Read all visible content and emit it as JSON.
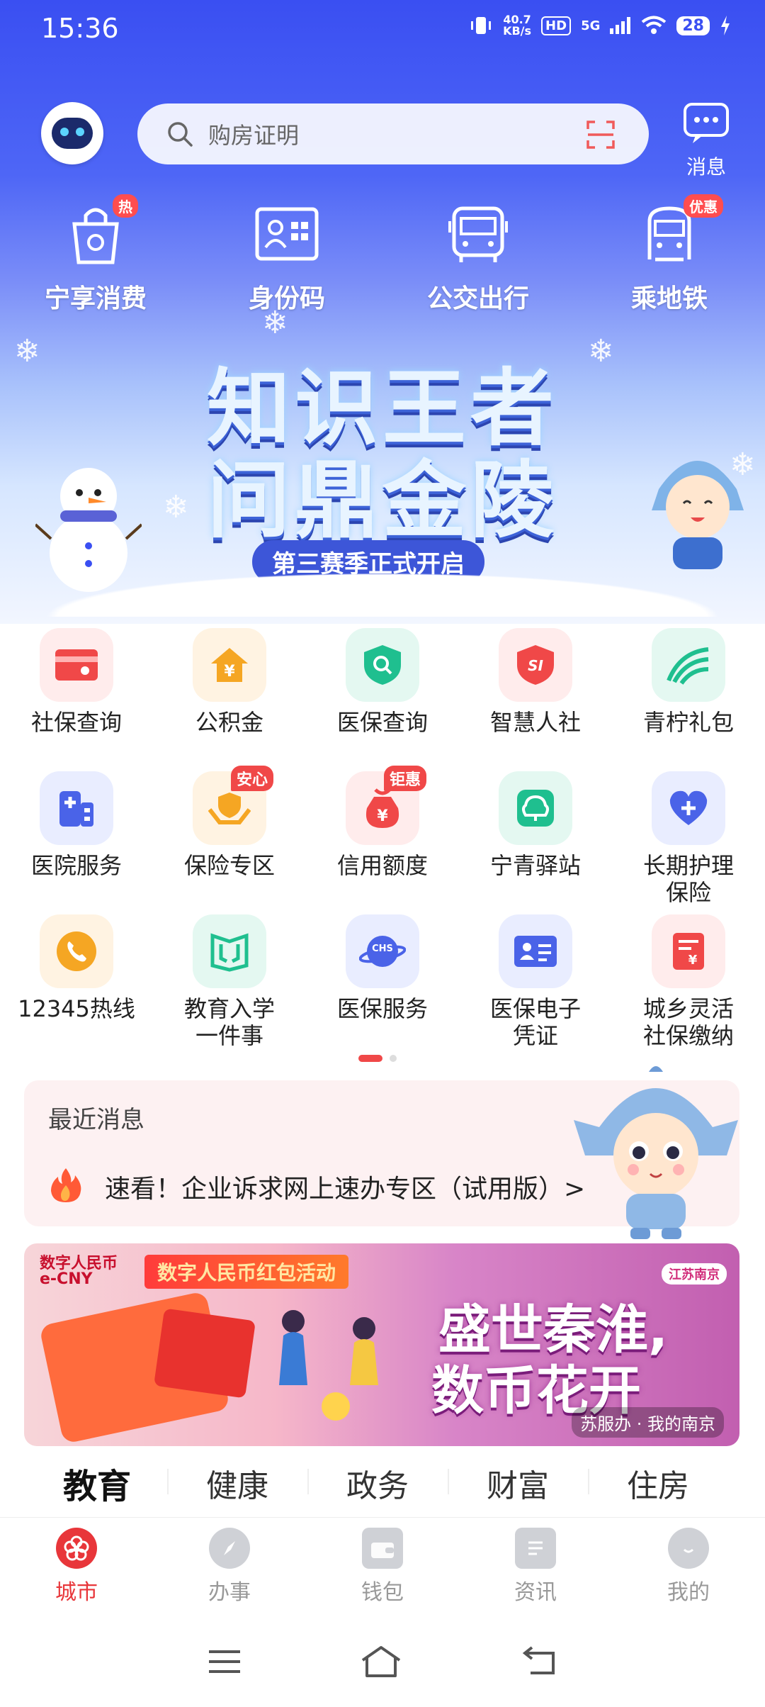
{
  "status_bar": {
    "time": "15:36",
    "net_speed_value": "40.7",
    "net_speed_unit": "KB/s",
    "hd": "HD",
    "network": "5G",
    "battery": "28"
  },
  "header": {
    "search_placeholder": "购房证明",
    "message_label": "消息"
  },
  "quick_actions": [
    {
      "label": "宁享消费",
      "tag": "热",
      "icon": "shopping-bag-icon"
    },
    {
      "label": "身份码",
      "tag": "",
      "icon": "id-card-icon"
    },
    {
      "label": "公交出行",
      "tag": "",
      "icon": "bus-icon"
    },
    {
      "label": "乘地铁",
      "tag": "优惠",
      "icon": "metro-icon"
    }
  ],
  "banner": {
    "line1": "知识王者",
    "line2": "问鼎金陵",
    "subtitle": "第三赛季正式开启"
  },
  "services": [
    {
      "label": "社保查询",
      "icon": "social-security-card-icon",
      "bg": "#ffecec",
      "fg": "#f04848",
      "tag": ""
    },
    {
      "label": "公积金",
      "icon": "house-fund-icon",
      "bg": "#fff3e2",
      "fg": "#f5a623",
      "tag": ""
    },
    {
      "label": "医保查询",
      "icon": "medical-search-icon",
      "bg": "#e4f8f1",
      "fg": "#1fbf8f",
      "tag": ""
    },
    {
      "label": "智慧人社",
      "icon": "si-shield-icon",
      "bg": "#ffecec",
      "fg": "#f04848",
      "tag": ""
    },
    {
      "label": "青柠礼包",
      "icon": "lemon-gift-icon",
      "bg": "#e4f8f1",
      "fg": "#1fbf8f",
      "tag": ""
    },
    {
      "label": "医院服务",
      "icon": "hospital-icon",
      "bg": "#e9edff",
      "fg": "#4a63e8",
      "tag": ""
    },
    {
      "label": "保险专区",
      "icon": "insurance-hands-icon",
      "bg": "#fff3e2",
      "fg": "#f5a623",
      "tag": "安心"
    },
    {
      "label": "信用额度",
      "icon": "credit-bag-icon",
      "bg": "#ffecec",
      "fg": "#f04848",
      "tag": "钜惠"
    },
    {
      "label": "宁青驿站",
      "icon": "youth-station-icon",
      "bg": "#e4f8f1",
      "fg": "#1fbf8f",
      "tag": ""
    },
    {
      "label": "长期护理\n保险",
      "icon": "heart-plus-icon",
      "bg": "#e9edff",
      "fg": "#4a63e8",
      "tag": ""
    },
    {
      "label": "12345热线",
      "icon": "phone-icon",
      "bg": "#fff3e2",
      "fg": "#f5a623",
      "tag": ""
    },
    {
      "label": "教育入学\n一件事",
      "icon": "education-book-icon",
      "bg": "#e4f8f1",
      "fg": "#1fbf8f",
      "tag": ""
    },
    {
      "label": "医保服务",
      "icon": "chs-planet-icon",
      "bg": "#e9edff",
      "fg": "#4a63e8",
      "tag": ""
    },
    {
      "label": "医保电子\n凭证",
      "icon": "medical-card-icon",
      "bg": "#e9edff",
      "fg": "#4a63e8",
      "tag": ""
    },
    {
      "label": "城乡灵活\n社保缴纳",
      "icon": "payment-slip-icon",
      "bg": "#ffecec",
      "fg": "#f04848",
      "tag": ""
    }
  ],
  "news": {
    "title": "最近消息",
    "text": "速看！企业诉求网上速办专区（试用版）>"
  },
  "promo": {
    "ecny_line1": "数字人民币",
    "ecny_line2": "e-CNY",
    "tag": "数字人民币红包活动",
    "location": "江苏南京",
    "headline1": "盛世秦淮,",
    "headline2": "数币花开",
    "footer": "苏服办 · 我的南京"
  },
  "categories": [
    "教育",
    "健康",
    "政务",
    "财富",
    "住房"
  ],
  "bottom_nav": [
    {
      "label": "城市",
      "icon": "city-flower-icon",
      "active": true
    },
    {
      "label": "办事",
      "icon": "compass-icon",
      "active": false
    },
    {
      "label": "钱包",
      "icon": "wallet-icon",
      "active": false
    },
    {
      "label": "资讯",
      "icon": "news-doc-icon",
      "active": false
    },
    {
      "label": "我的",
      "icon": "profile-smile-icon",
      "active": false
    }
  ],
  "colors": {
    "primary_blue": "#3a4ff2",
    "accent_red": "#e8363a"
  }
}
